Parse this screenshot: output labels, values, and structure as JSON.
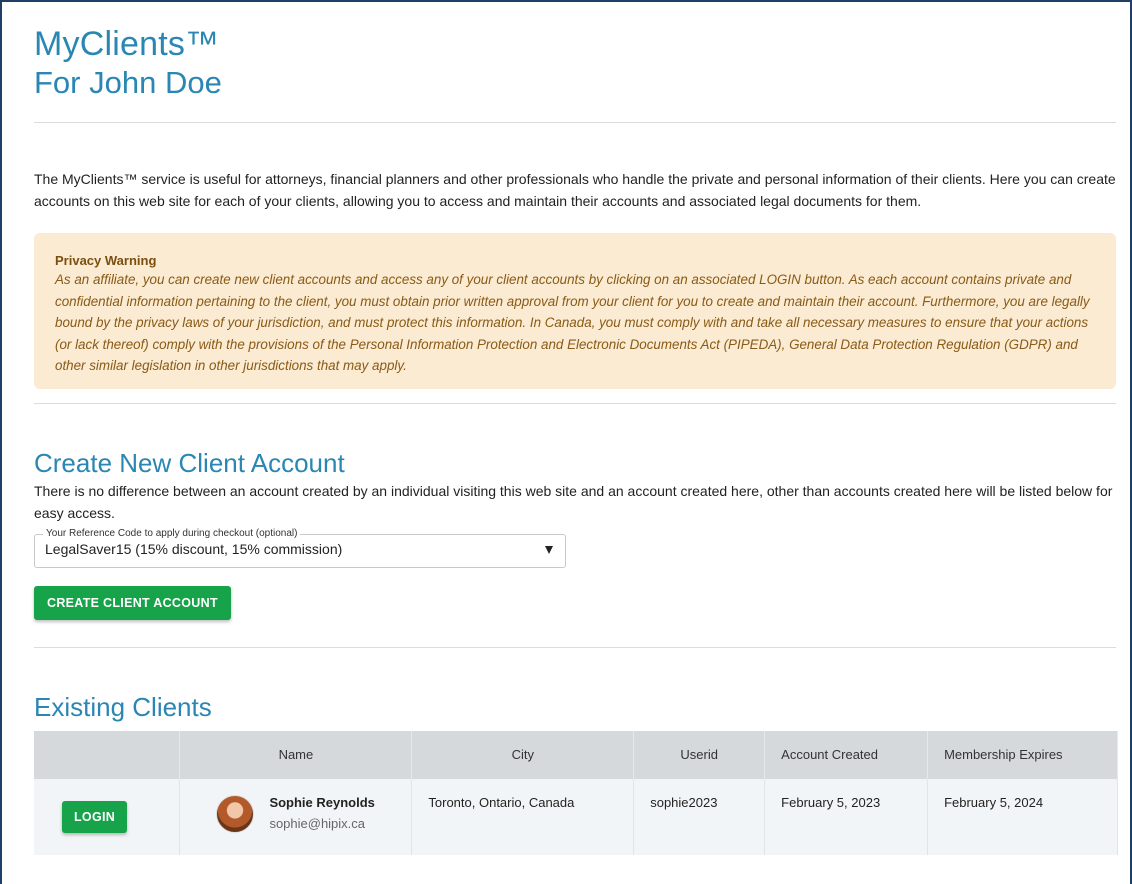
{
  "header": {
    "title": "MyClients™",
    "subtitle": "For John Doe"
  },
  "intro": "The MyClients™ service is useful for attorneys, financial planners and other professionals who handle the private and personal information of their clients. Here you can create accounts on this web site for each of your clients, allowing you to access and maintain their accounts and associated legal documents for them.",
  "privacy_warning": {
    "title": "Privacy Warning",
    "body": "As an affiliate, you can create new client accounts and access any of your client accounts by clicking on an associated LOGIN button. As each account contains private and confidential information pertaining to the client, you must obtain prior written approval from your client for you to create and maintain their account. Furthermore, you are legally bound by the privacy laws of your jurisdiction, and must protect this information. In Canada, you must comply with and take all necessary measures to ensure that your actions (or lack thereof) comply with the provisions of the Personal Information Protection and Electronic Documents Act (PIPEDA), General Data Protection Regulation (GDPR) and other similar legislation in other jurisdictions that may apply."
  },
  "create": {
    "heading": "Create New Client Account",
    "description": "There is no difference between an account created by an individual visiting this web site and an account created here, other than accounts created here will be listed below for easy access.",
    "select_label": "Your Reference Code to apply during checkout (optional)",
    "select_value": "LegalSaver15 (15% discount, 15% commission)",
    "button_label": "CREATE CLIENT ACCOUNT"
  },
  "existing": {
    "heading": "Existing Clients",
    "columns": {
      "name": "Name",
      "city": "City",
      "userid": "Userid",
      "created": "Account Created",
      "expires": "Membership Expires"
    },
    "rows": [
      {
        "login_label": "LOGIN",
        "name": "Sophie Reynolds",
        "email": "sophie@hipix.ca",
        "city": "Toronto, Ontario, Canada",
        "userid": "sophie2023",
        "created": "February 5, 2023",
        "expires": "February 5, 2024"
      }
    ]
  },
  "colors": {
    "accent": "#2a86b3",
    "button": "#16a34a",
    "warning_bg": "#faebd2",
    "warning_text": "#8a5a16"
  },
  "icons": {
    "select_arrow": "dropdown-arrow-icon",
    "avatar": "user-avatar"
  }
}
